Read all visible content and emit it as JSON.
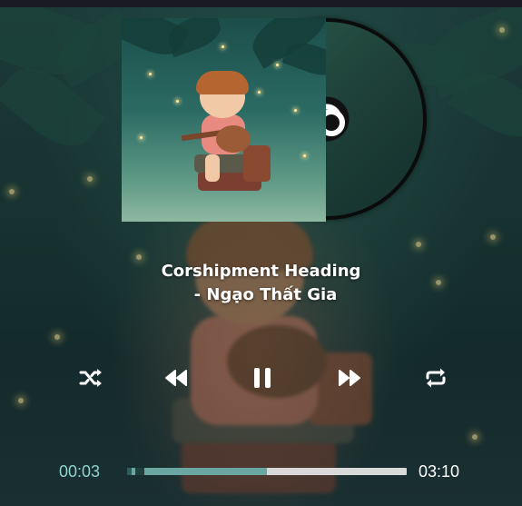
{
  "player": {
    "song_title": "Corshipment Heading",
    "artist_line": "- Ngạo Thất Gia",
    "current_time": "00:03",
    "total_time": "03:10",
    "progress_fraction": 0.016,
    "buffered_fraction": 0.5
  },
  "controls": {
    "shuffle_icon": "shuffle-icon",
    "prev_icon": "rewind-icon",
    "play_pause_icon": "pause-icon",
    "next_icon": "fast-forward-icon",
    "repeat_icon": "repeat-icon"
  },
  "colors": {
    "accent": "#8fd3cf",
    "track": "#d9d9d9",
    "buffer": "#6aa7a3",
    "played": "#2c5d5a"
  }
}
